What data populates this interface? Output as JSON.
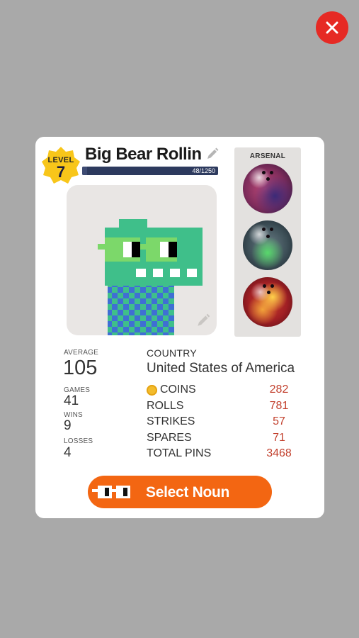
{
  "close_icon": "close-icon",
  "profile": {
    "level_label": "LEVEL",
    "level": "7",
    "name": "Big Bear Rollin",
    "xp_text": "48/1250",
    "xp_progress": 0.0384
  },
  "arsenal": {
    "title": "ARSENAL",
    "balls": [
      {
        "name": "purple-pink-ball"
      },
      {
        "name": "green-gray-ball"
      },
      {
        "name": "red-yellow-ball"
      }
    ]
  },
  "stats": {
    "average_label": "AVERAGE",
    "average": "105",
    "games_label": "GAMES",
    "games": "41",
    "wins_label": "WINS",
    "wins": "9",
    "losses_label": "LOSSES",
    "losses": "4"
  },
  "details": {
    "country_label": "COUNTRY",
    "country": "United States of America",
    "coins_label": "COINS",
    "coins": "282",
    "rolls_label": "ROLLS",
    "rolls": "781",
    "strikes_label": "STRIKES",
    "strikes": "57",
    "spares_label": "SPARES",
    "spares": "71",
    "total_pins_label": "TOTAL PINS",
    "total_pins": "3468"
  },
  "select_button": {
    "label": "Select Noun",
    "icon": "noun-glasses-icon"
  },
  "colors": {
    "accent_orange": "#f36612",
    "close_red": "#e62a24",
    "value_red": "#c2402d",
    "level_yellow": "#f8c61a",
    "avatar_green": "#3fbf8a"
  }
}
